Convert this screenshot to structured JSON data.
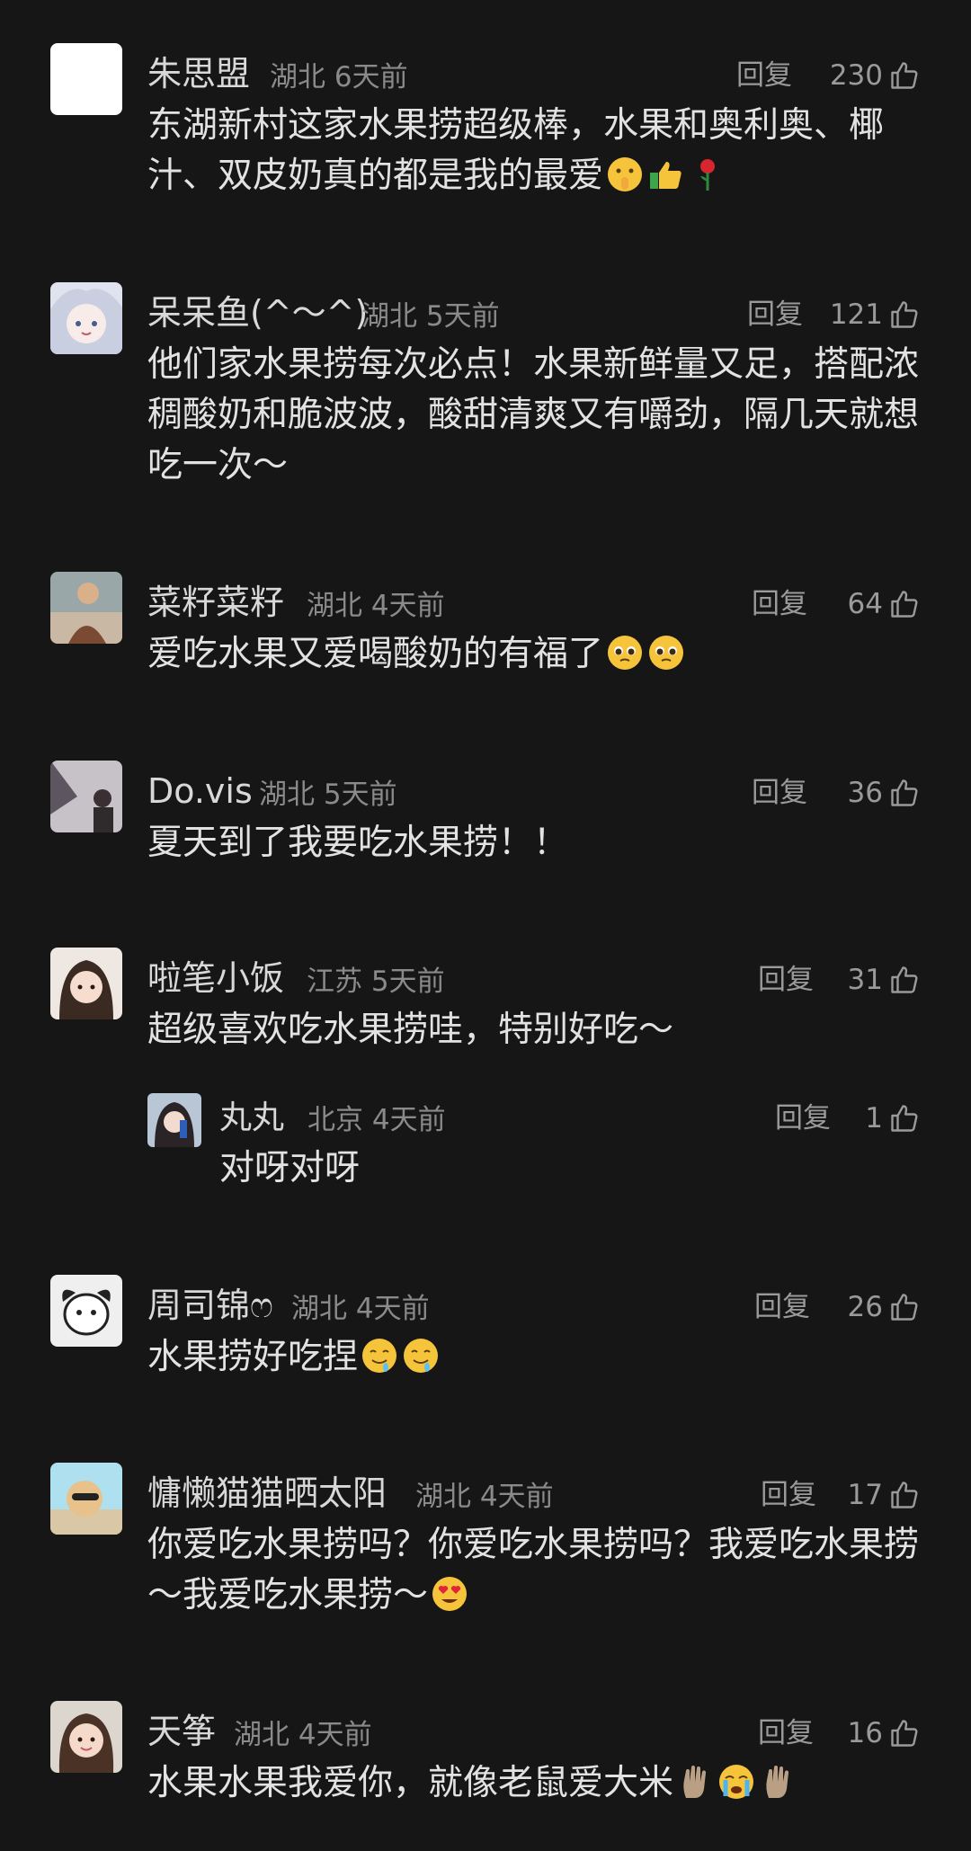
{
  "comments": [
    {
      "user": "朱思盟",
      "location": "湖北",
      "time": "6天前",
      "reply": "回复",
      "likes": "230",
      "text": "东湖新村这家水果捞超级棒，水果和奥利奥、椰汁、双皮奶真的都是我的最爱",
      "emojis": [
        "shushing-face",
        "thumbs-up",
        "rose"
      ]
    },
    {
      "user": "呆呆鱼(^～^)",
      "location": "湖北",
      "time": "5天前",
      "reply": "回复",
      "likes": "121",
      "text": "他们家水果捞每次必点！水果新鲜量又足，搭配浓稠酸奶和脆波波，酸甜清爽又有嚼劲，隔几天就想吃一次～",
      "emojis": []
    },
    {
      "user": "菜籽菜籽",
      "location": "湖北",
      "time": "4天前",
      "reply": "回复",
      "likes": "64",
      "text": "爱吃水果又爱喝酸奶的有福了",
      "emojis": [
        "pleading-face",
        "pleading-face"
      ]
    },
    {
      "user": "Do.vis",
      "location": "湖北",
      "time": "5天前",
      "reply": "回复",
      "likes": "36",
      "text": "夏天到了我要吃水果捞！！",
      "emojis": []
    },
    {
      "user": "啦笔小饭",
      "location": "江苏",
      "time": "5天前",
      "reply": "回复",
      "likes": "31",
      "text": "超级喜欢吃水果捞哇，特别好吃～",
      "emojis": []
    },
    {
      "user": "丸丸",
      "location": "北京",
      "time": "4天前",
      "reply": "回复",
      "likes": "1",
      "text": "对呀对呀",
      "emojis": []
    },
    {
      "user": "周司锦ෆ",
      "location": "湖北",
      "time": "4天前",
      "reply": "回复",
      "likes": "26",
      "text": "水果捞好吃捏",
      "emojis": [
        "drooling-face",
        "drooling-face"
      ]
    },
    {
      "user": "慵懒猫猫晒太阳",
      "location": "湖北",
      "time": "4天前",
      "reply": "回复",
      "likes": "17",
      "text": "你爱吃水果捞吗？你爱吃水果捞吗？我爱吃水果捞～我爱吃水果捞～",
      "emojis": [
        "heart-eyes-face"
      ]
    },
    {
      "user": "天筝",
      "location": "湖北",
      "time": "4天前",
      "reply": "回复",
      "likes": "16",
      "text": "水果水果我爱你，就像老鼠爱大米",
      "emojis": [
        "waving-hand",
        "crying-face",
        "raised-hand"
      ]
    }
  ],
  "colors": {
    "background": "#161616",
    "text": "#e2e2e2",
    "muted": "#8a8a8a"
  }
}
